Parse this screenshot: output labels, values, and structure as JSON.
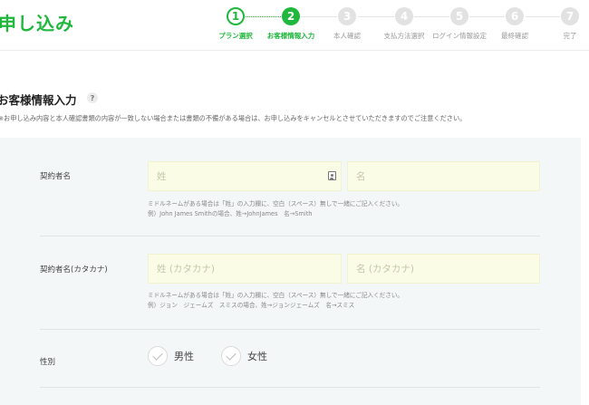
{
  "brand": {
    "title": "申し込み",
    "color": "#1fb83c"
  },
  "steps": [
    {
      "number": "1",
      "label": "プラン選択",
      "state": "done"
    },
    {
      "number": "2",
      "label": "お客様情報入力",
      "state": "current"
    },
    {
      "number": "3",
      "label": "本人確認",
      "state": "todo"
    },
    {
      "number": "4",
      "label": "支払方法選択",
      "state": "todo"
    },
    {
      "number": "5",
      "label": "ログイン情報設定",
      "state": "todo"
    },
    {
      "number": "6",
      "label": "最終確認",
      "state": "todo"
    },
    {
      "number": "7",
      "label": "完了",
      "state": "todo"
    }
  ],
  "section": {
    "title": "お客様情報入力",
    "help_icon": "?",
    "notice": "※お申し込み内容と本人確認書類の内容が一致しない場合または書類の不備がある場合は、お申し込みをキャンセルとさせていただきますのでご注意ください。"
  },
  "form": {
    "name": {
      "label": "契約者名",
      "last_placeholder": "姓",
      "first_placeholder": "名",
      "contact_icon": "contact-card-icon",
      "hint_line1": "ミドルネームがある場合は「姓」の入力欄に、空白（スペース）無しで一緒にご記入ください。",
      "hint_line2": "例）John James Smithの場合、姓→JohnJames　名→Smith"
    },
    "kana": {
      "label": "契約者名(カタカナ)",
      "last_placeholder": "姓 (カタカナ)",
      "first_placeholder": "名 (カタカナ)",
      "hint_line1": "ミドルネームがある場合は「姓」の入力欄に、空白（スペース）無しで一緒にご記入ください。",
      "hint_line2": "例）ジョン　ジェームズ　スミスの場合、姓→ジョンジェームズ　名→スミス"
    },
    "gender": {
      "label": "性別",
      "options": [
        "男性",
        "女性"
      ]
    }
  },
  "colors": {
    "accent": "#1fb83c",
    "input_bg": "#fbfce5",
    "panel_bg": "#f4f7f7"
  }
}
